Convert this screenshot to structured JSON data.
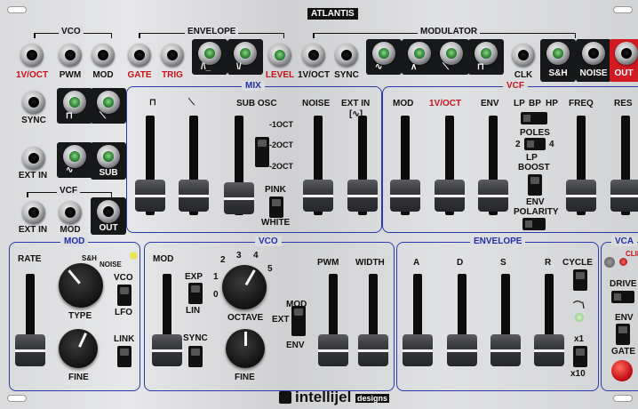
{
  "brand": {
    "title": "ATLANTIS",
    "maker": "intellijel",
    "maker_suffix": "designs"
  },
  "top": {
    "vco_group": "VCO",
    "envelope_group": "ENVELOPE",
    "modulator_group": "MODULATOR",
    "jacks": [
      "1V/OCT",
      "PWM",
      "MOD",
      "GATE",
      "TRIG",
      "LEVEL",
      "1V/OCT",
      "SYNC",
      "CLK",
      "S&H",
      "NOISE",
      "OUT"
    ]
  },
  "left": {
    "sync": "SYNC",
    "ext_in": "EXT IN",
    "sub": "SUB",
    "vcf_group": "VCF",
    "ext_in2": "EXT IN",
    "mod": "MOD",
    "out": "OUT"
  },
  "mix": {
    "title": "MIX",
    "labels": [
      "SUB OSC",
      "NOISE",
      "EXT IN"
    ],
    "ext_in_sub": "[∿]",
    "oct": [
      "-1OCT",
      "-2OCT",
      "-2OCT"
    ],
    "pink": "PINK",
    "white": "WHITE"
  },
  "vcf": {
    "title": "VCF",
    "labels": [
      "MOD",
      "1V/OCT",
      "ENV",
      "FREQ",
      "RES"
    ],
    "lp": "LP",
    "bp": "BP",
    "hp": "HP",
    "poles": "POLES",
    "p2": "2",
    "p4": "4",
    "lp_boost": "LP",
    "boost": "BOOST",
    "env_polarity": "ENV",
    "polarity": "POLARITY"
  },
  "mod": {
    "title": "MOD",
    "rate": "RATE",
    "sh": "S&H",
    "noise": "NOISE",
    "type": "TYPE",
    "vco": "VCO",
    "lfo": "LFO",
    "link": "LINK",
    "fine": "FINE"
  },
  "vco": {
    "title": "VCO",
    "mod": "MOD",
    "exp": "EXP",
    "lin": "LIN",
    "sync": "SYNC",
    "octave": "OCTAVE",
    "fine": "FINE",
    "nums": [
      "0",
      "1",
      "2",
      "3",
      "4",
      "5"
    ],
    "pwm": "PWM",
    "width": "WIDTH",
    "mod2": "MOD",
    "ext": "EXT",
    "env": "ENV"
  },
  "envelope": {
    "title": "ENVELOPE",
    "labels": [
      "A",
      "D",
      "S",
      "R"
    ],
    "cycle": "CYCLE",
    "x1": "x1",
    "x10": "x10"
  },
  "vca": {
    "title": "VCA",
    "clip": "CLIP",
    "drive": "DRIVE",
    "env": "ENV",
    "gate": "GATE"
  },
  "colors": {
    "accent_blue": "#1f2fa8",
    "label_red": "#c8121b",
    "out_red": "#d11b22"
  }
}
